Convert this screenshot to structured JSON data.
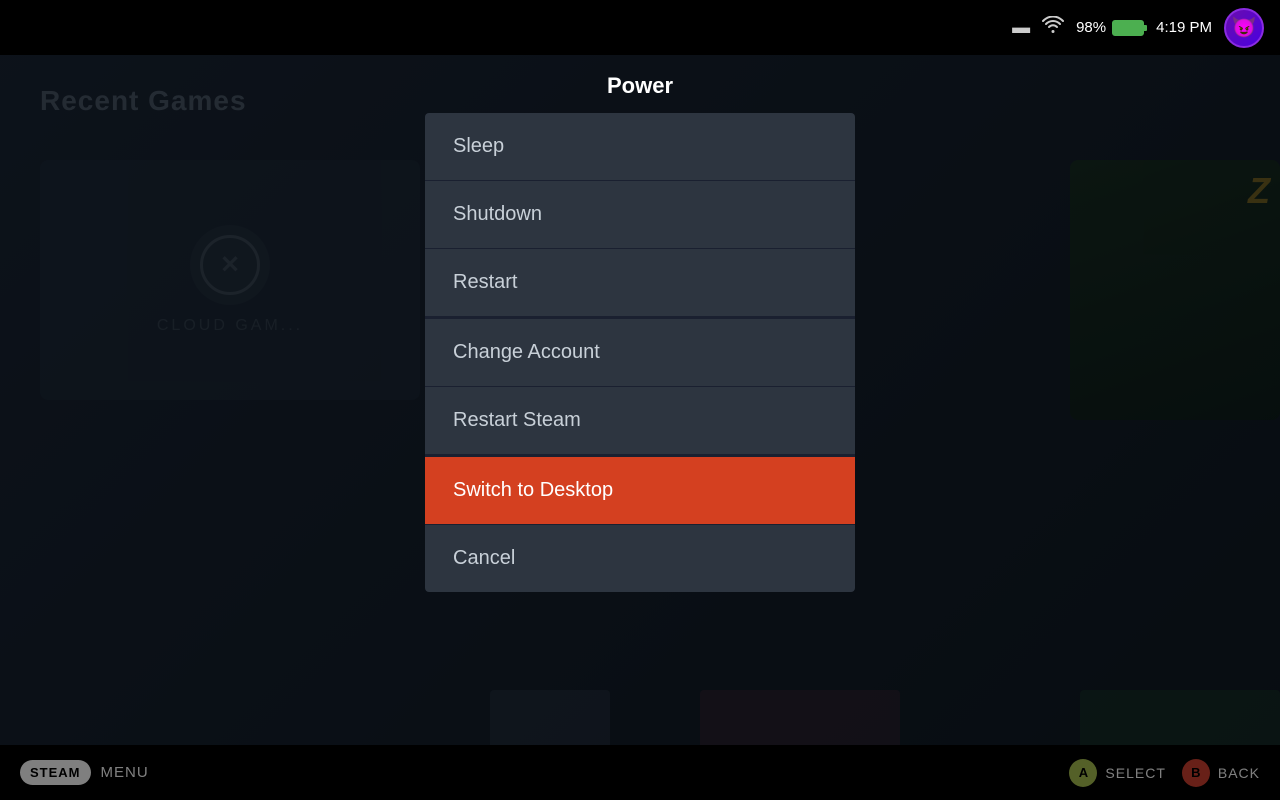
{
  "topbar": {
    "battery_percent": "98%",
    "time": "4:19 PM"
  },
  "background": {
    "recent_games_label": "Recent Games",
    "cloud_gaming_label": "CLOUD GAM..."
  },
  "power_dialog": {
    "title": "Power",
    "menu_items": [
      {
        "id": "sleep",
        "label": "Sleep",
        "highlighted": false
      },
      {
        "id": "shutdown",
        "label": "Shutdown",
        "highlighted": false
      },
      {
        "id": "restart",
        "label": "Restart",
        "highlighted": false
      },
      {
        "id": "change-account",
        "label": "Change Account",
        "highlighted": false
      },
      {
        "id": "restart-steam",
        "label": "Restart Steam",
        "highlighted": false
      },
      {
        "id": "switch-to-desktop",
        "label": "Switch to Desktop",
        "highlighted": true
      },
      {
        "id": "cancel",
        "label": "Cancel",
        "highlighted": false
      }
    ]
  },
  "bottombar": {
    "steam_label": "STEAM",
    "menu_label": "MENU",
    "select_label": "SELECT",
    "back_label": "BACK",
    "a_button": "A",
    "b_button": "B"
  }
}
